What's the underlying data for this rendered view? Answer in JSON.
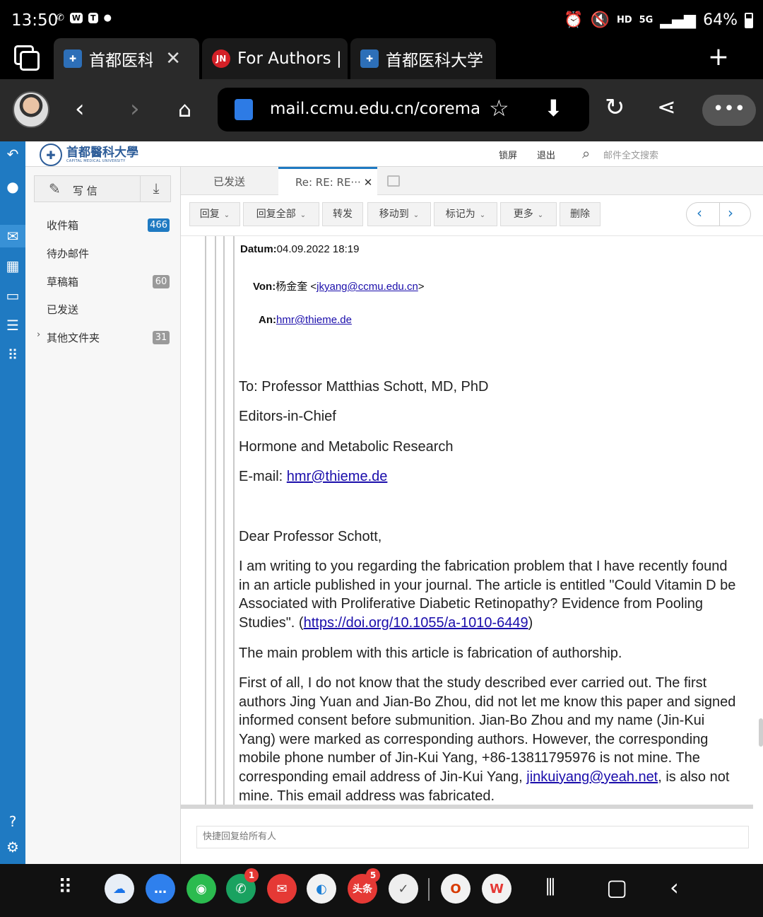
{
  "status": {
    "time": "13:50",
    "battery": "64%",
    "network": "5G",
    "hd": "HD"
  },
  "browser": {
    "tabs": [
      {
        "label": "首都医科大学"
      },
      {
        "label": "For Authors |"
      },
      {
        "label": "首都医科大学"
      }
    ],
    "url": "mail.ccmu.edu.cn/coremail"
  },
  "mail": {
    "logo": {
      "name": "首都醫科大學",
      "sub": "CAPITAL MEDICAL UNIVERSITY"
    },
    "topbar": {
      "lock": "锁屏",
      "logout": "退出",
      "search_placeholder": "邮件全文搜索"
    },
    "compose": "写 信",
    "folders": [
      {
        "label": "收件箱",
        "count": "466"
      },
      {
        "label": "待办邮件",
        "count": ""
      },
      {
        "label": "草稿箱",
        "count": "60"
      },
      {
        "label": "已发送",
        "count": ""
      },
      {
        "label": "其他文件夹",
        "count": "31"
      }
    ],
    "tabs": [
      {
        "label": "已发送"
      },
      {
        "label": "Re: RE: RE···"
      }
    ],
    "toolbar": {
      "reply": "回复",
      "reply_all": "回复全部",
      "forward": "转发",
      "move": "移动到",
      "mark": "标记为",
      "more": "更多",
      "delete": "删除"
    },
    "quick_reply_placeholder": "快捷回复给所有人"
  },
  "message": {
    "datum_label": "Datum:",
    "datum": "04.09.2022 18:19",
    "von_label": "Von:",
    "von_name": "杨金奎 <",
    "von_email": "jkyang@ccmu.edu.cn",
    "von_close": ">",
    "an_label": "An:",
    "an_email": "hmr@thieme.de",
    "to_line": "To: Professor Matthias Schott, MD, PhD",
    "editors": "Editors-in-Chief",
    "journal": "Hormone and Metabolic Research",
    "email_prefix": "E-mail: ",
    "email": "hmr@thieme.de",
    "greeting": "Dear Professor Schott,",
    "p1_text": "I am writing to you regarding the fabrication problem that I have recently found in an article published in your journal. The article is entitled \"Could Vitamin D be Associated with Proliferative Diabetic Retinopathy? Evidence from Pooling Studies\". (",
    "p1_link": "https://doi.org/10.1055/a-1010-6449",
    "p1_close": ")",
    "p2": "The main problem with this article is fabrication of authorship.",
    "p3_text": "First of all, I do not know that the study described ever carried out. The first authors Jing Yuan and Jian-Bo Zhou, did not let me know this paper and signed informed consent before submunition. Jian-Bo Zhou and my name (Jin-Kui Yang) were marked as corresponding authors. However, the corresponding mobile phone number of Jin-Kui Yang, +86-13811795976 is not mine. The corresponding email address of Jin-Kui Yang, ",
    "p3_link": "jinkuiyang@yeah.net",
    "p3_tail": ", is also not mine. This email address was fabricated."
  },
  "dock": {
    "badges": {
      "phone": "1",
      "toutiao": "5"
    },
    "toutiao_label": "头条"
  }
}
